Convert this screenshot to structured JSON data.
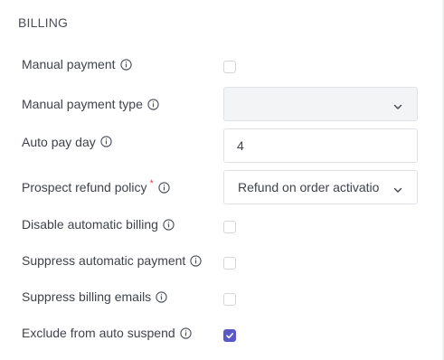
{
  "section": {
    "title": "BILLING"
  },
  "fields": {
    "manual_payment": {
      "label": "Manual payment",
      "checked": false
    },
    "manual_payment_type": {
      "label": "Manual payment type",
      "value": ""
    },
    "auto_pay_day": {
      "label": "Auto pay day",
      "value": "4"
    },
    "prospect_refund_policy": {
      "label": "Prospect refund policy",
      "required_mark": "*",
      "value": "Refund on order activatio"
    },
    "disable_automatic_billing": {
      "label": "Disable automatic billing",
      "checked": false
    },
    "suppress_automatic_payment": {
      "label": "Suppress automatic payment",
      "checked": false
    },
    "suppress_billing_emails": {
      "label": "Suppress billing emails",
      "checked": false
    },
    "exclude_from_auto_suspend": {
      "label": "Exclude from auto suspend",
      "checked": true
    }
  },
  "icons": {
    "info": "info-circle-icon",
    "chevron": "chevron-down-icon",
    "check": "checkmark-icon"
  },
  "colors": {
    "accent": "#5a58c7",
    "required": "#e0465b",
    "text": "#3f4349",
    "border": "#dfe2e7",
    "disabled_bg": "#f3f4f6"
  }
}
